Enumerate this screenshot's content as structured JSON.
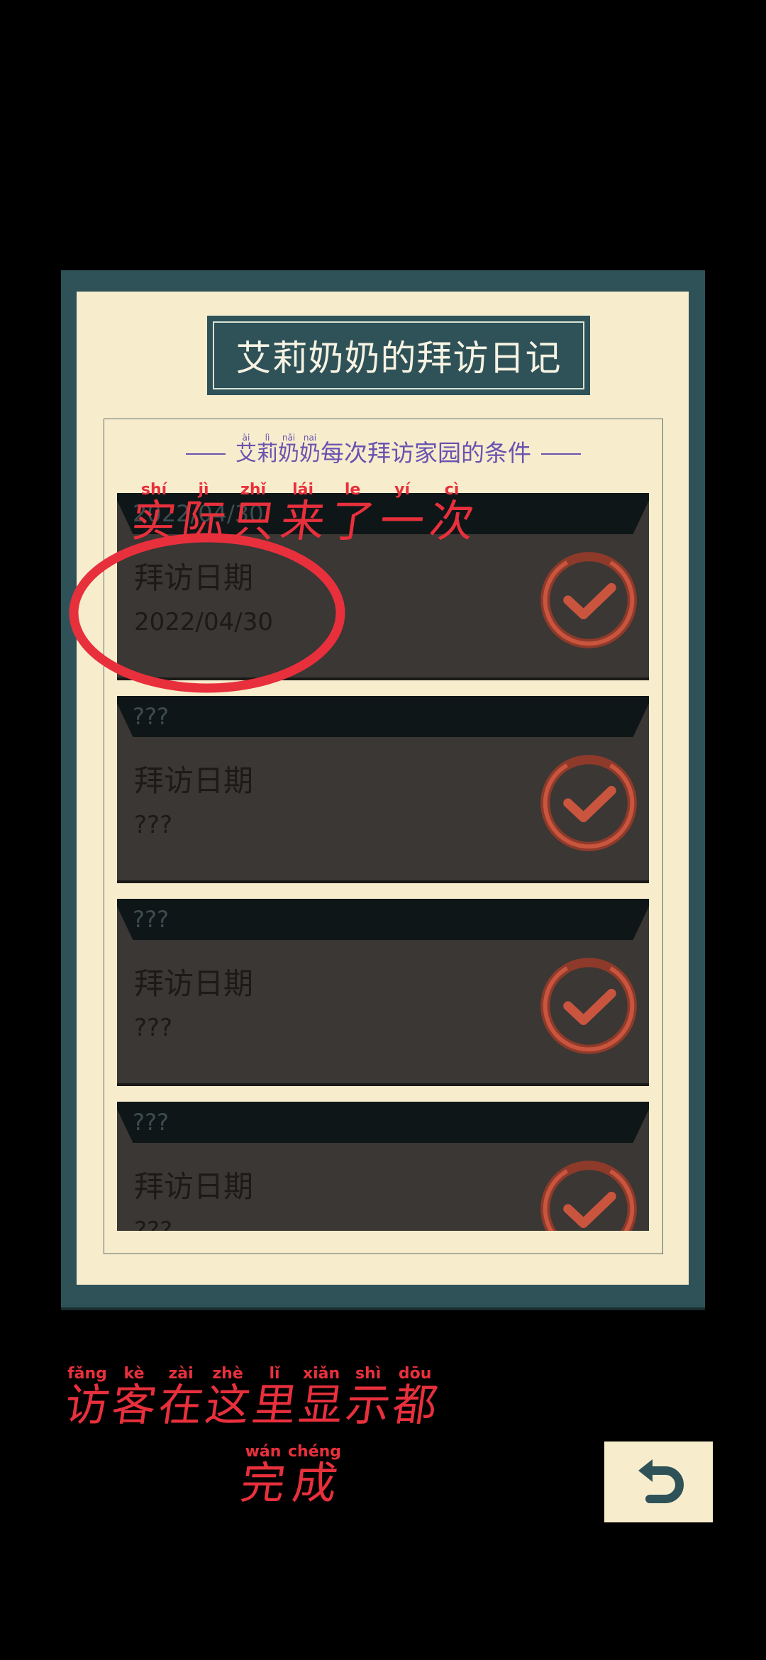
{
  "diary": {
    "title": "艾莉奶奶的拜访日记",
    "subtitle_name_chars": [
      {
        "ch": "艾",
        "py": "ài"
      },
      {
        "ch": "莉",
        "py": "lì"
      },
      {
        "ch": "奶",
        "py": "nǎi"
      },
      {
        "ch": "奶",
        "py": "nai"
      }
    ],
    "subtitle_rest": "每次拜访家园的条件",
    "cards": [
      {
        "header": "2022/04/30",
        "label": "拜访日期",
        "value": "2022/04/30",
        "icon": "check-circle-icon"
      },
      {
        "header": "???",
        "label": "拜访日期",
        "value": "???",
        "icon": "check-circle-icon"
      },
      {
        "header": "???",
        "label": "拜访日期",
        "value": "???",
        "icon": "check-circle-icon"
      },
      {
        "header": "???",
        "label": "拜访日期",
        "value": "???",
        "icon": "check-circle-icon"
      }
    ]
  },
  "annotations": {
    "top_note": [
      {
        "ch": "实",
        "py": "shí"
      },
      {
        "ch": "际",
        "py": "jì"
      },
      {
        "ch": "只",
        "py": "zhǐ"
      },
      {
        "ch": "来",
        "py": "lái"
      },
      {
        "ch": "了",
        "py": "le"
      },
      {
        "ch": "一",
        "py": "yí"
      },
      {
        "ch": "次",
        "py": "cì"
      }
    ],
    "bottom_note_line1": [
      {
        "ch": "访",
        "py": "fǎng"
      },
      {
        "ch": "客",
        "py": "kè"
      },
      {
        "ch": "在",
        "py": "zài"
      },
      {
        "ch": "这",
        "py": "zhè"
      },
      {
        "ch": "里",
        "py": "lǐ"
      },
      {
        "ch": "显",
        "py": "xiǎn"
      },
      {
        "ch": "示",
        "py": "shì"
      },
      {
        "ch": "都",
        "py": "dōu"
      }
    ],
    "bottom_note_line2": [
      {
        "ch": "完",
        "py": "wán"
      },
      {
        "ch": "成",
        "py": "chéng"
      }
    ],
    "color": "#e8303c"
  },
  "back_button": {
    "icon": "undo-arrow-icon"
  },
  "colors": {
    "frame": "#2f5258",
    "paper": "#f7edcd",
    "card": "#3a3734",
    "card_header": "#0f1618",
    "accent_subtitle": "#6a52b0"
  }
}
